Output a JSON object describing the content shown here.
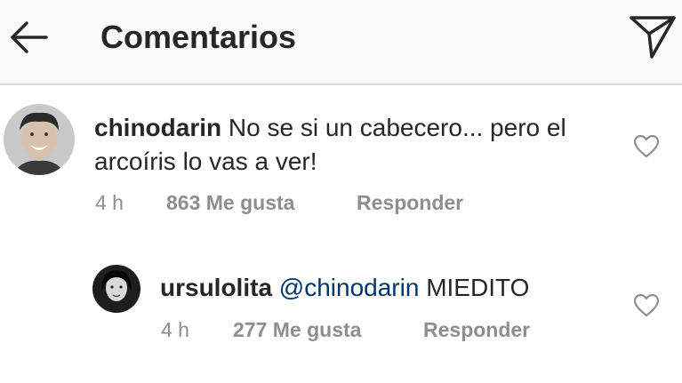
{
  "header": {
    "title": "Comentarios"
  },
  "comments": [
    {
      "username": "chinodarin",
      "text": "No se si un cabecero... pero el arcoíris lo vas a ver!",
      "time": "4 h",
      "likes": "863 Me gusta",
      "reply": "Responder"
    },
    {
      "username": "ursulolita",
      "mention": "@chinodarin",
      "text": "MIEDITO",
      "time": "4 h",
      "likes": "277 Me gusta",
      "reply": "Responder"
    }
  ],
  "colors": {
    "mention": "#00376b",
    "meta": "#8e8e8e",
    "text": "#262626"
  }
}
